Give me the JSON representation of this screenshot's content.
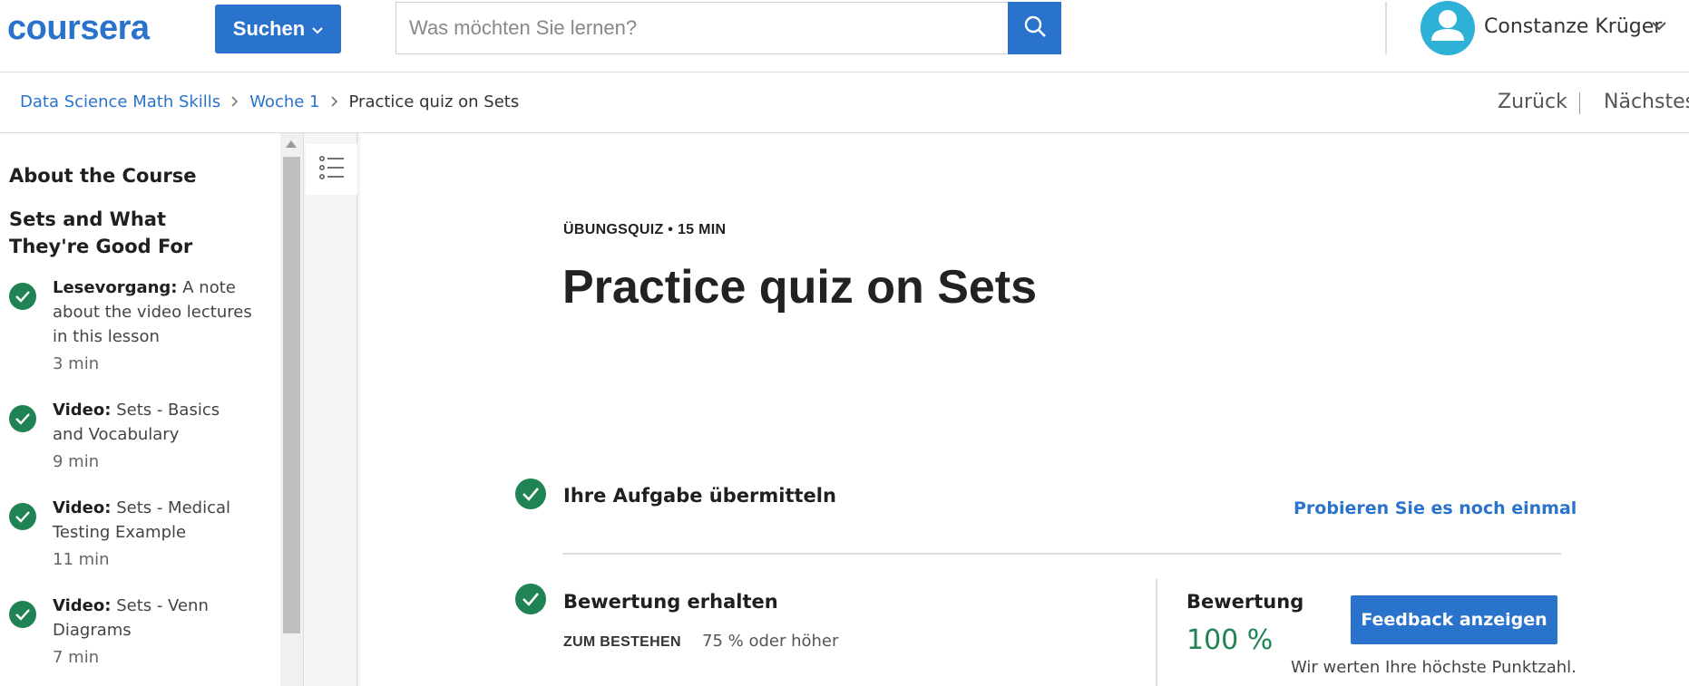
{
  "header": {
    "logo_text": "coursera",
    "search_menu_label": "Suchen",
    "search_placeholder": "Was möchten Sie lernen?",
    "user_name": "Constanze Krüger"
  },
  "breadcrumb": {
    "items": [
      "Data Science Math Skills",
      "Woche 1"
    ],
    "current": "Practice quiz on Sets"
  },
  "lesson_nav": {
    "prev_label": "Zurück",
    "next_label": "Nächstes"
  },
  "sidebar": {
    "headings": [
      "About the Course",
      "Sets and What They're Good For"
    ],
    "items": [
      {
        "type": "Lesevorgang:",
        "title": "A note about the video lectures in this lesson",
        "duration": "3 min"
      },
      {
        "type": "Video:",
        "title": "Sets - Basics and Vocabulary",
        "duration": "9 min"
      },
      {
        "type": "Video:",
        "title": "Sets - Medical Testing Example",
        "duration": "11 min"
      },
      {
        "type": "Video:",
        "title": "Sets - Venn Diagrams",
        "duration": "7 min"
      }
    ]
  },
  "main": {
    "eyebrow": "ÜBUNGSQUIZ • 15 MIN",
    "title": "Practice quiz on Sets",
    "submit": {
      "title": "Ihre Aufgabe übermitteln",
      "retry_label": "Probieren Sie es noch einmal"
    },
    "grade": {
      "title": "Bewertung erhalten",
      "pass_label": "ZUM BESTEHEN",
      "pass_value": "75 % oder höher",
      "grade_label": "Bewertung",
      "grade_value": "100 %",
      "feedback_label": "Feedback anzeigen",
      "note": "Wir werten Ihre höchste Punktzahl."
    }
  },
  "colors": {
    "brand_blue": "#2a73cc",
    "success_green": "#1f8354",
    "avatar_bg": "#2fb0d6"
  }
}
